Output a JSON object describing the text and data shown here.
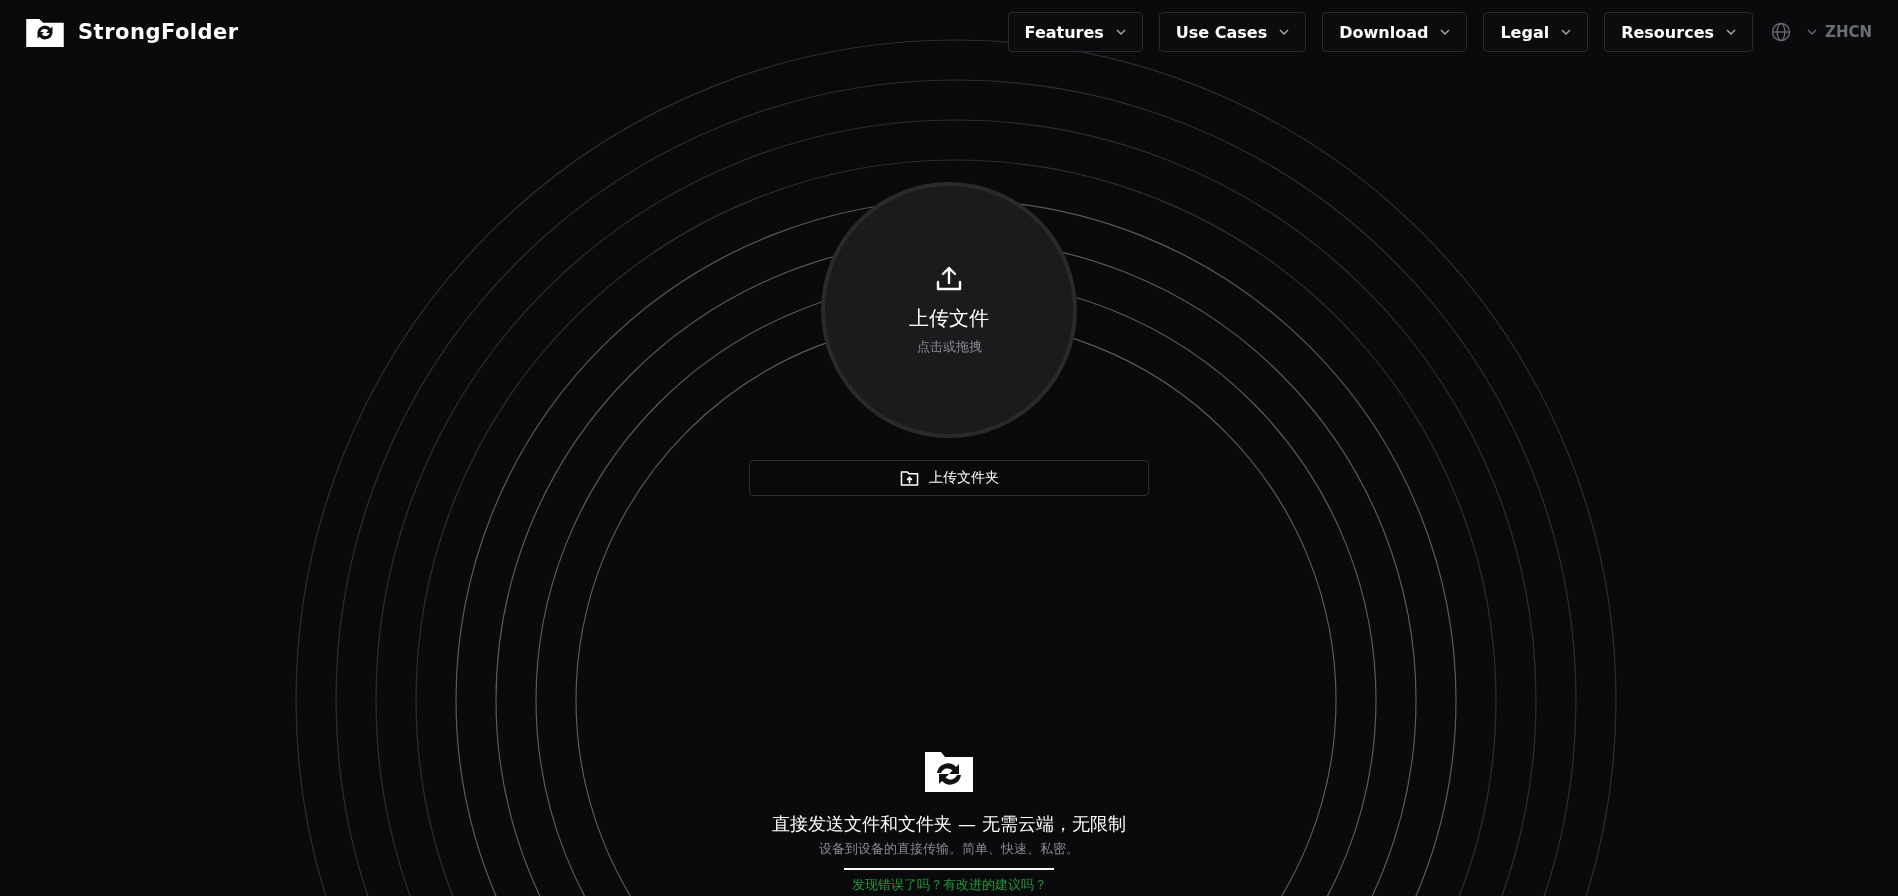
{
  "header": {
    "brand": "StrongFolder",
    "nav": [
      {
        "label": "Features"
      },
      {
        "label": "Use Cases"
      },
      {
        "label": "Download"
      },
      {
        "label": "Legal"
      },
      {
        "label": "Resources"
      }
    ],
    "language": "ZHCN"
  },
  "upload": {
    "title": "上传文件",
    "hint": "点击或拖拽",
    "folder_button": "上传文件夹"
  },
  "footer": {
    "headline": "直接发送文件和文件夹 — 无需云端，无限制",
    "subtitle": "设备到设备的直接传输。简单、快速、私密。",
    "feedback_link": "发现错误了吗？有改进的建议吗？"
  }
}
